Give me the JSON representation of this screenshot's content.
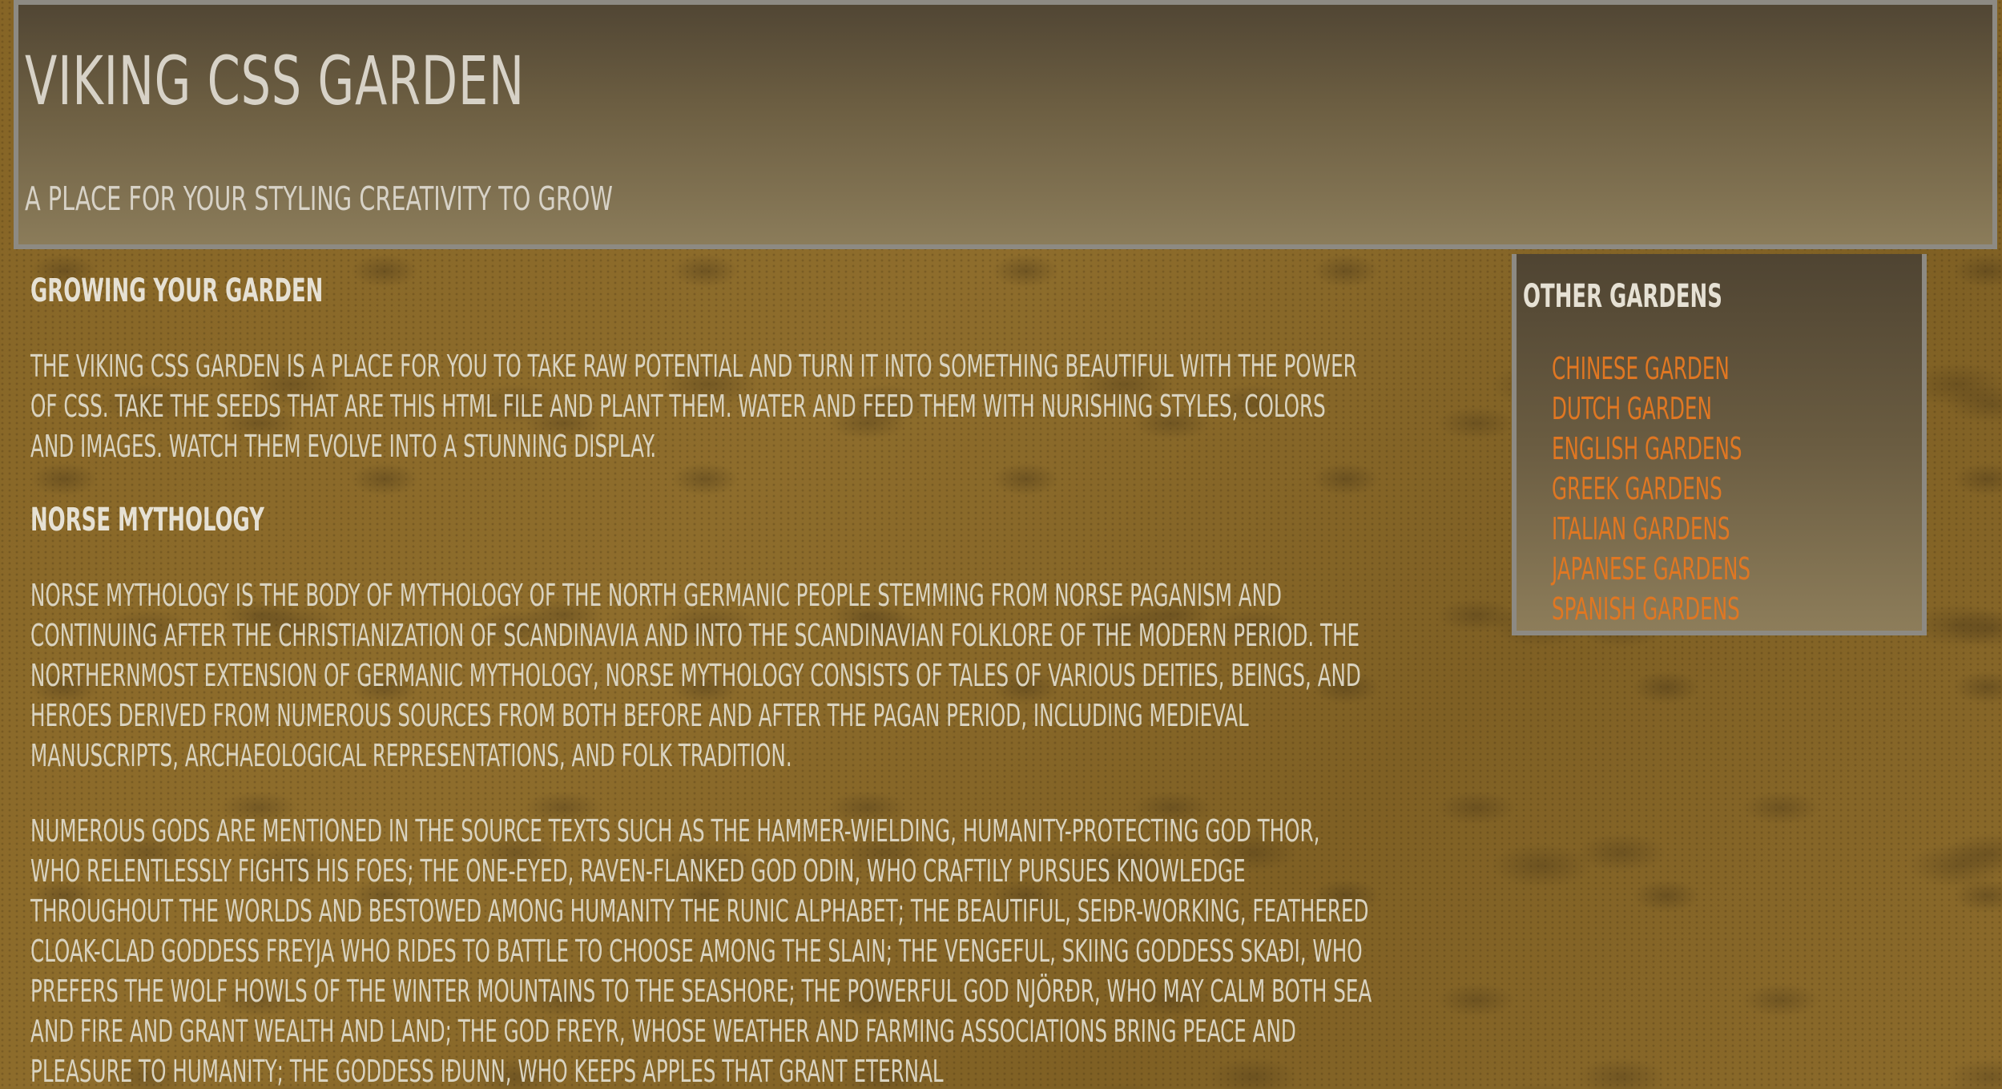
{
  "header": {
    "title": "Viking CSS Garden",
    "tagline": "A place for your styling creativity to grow"
  },
  "main": {
    "section1": {
      "heading": "Growing Your Garden",
      "paragraph": "The Viking CSS Garden is a place for you to take raw potential and turn it into something beautiful with the power of CSS. Take the seeds that are this HTML file and plant them. Water and feed them with nurishing styles, colors and images. Watch them evolve into a stunning display."
    },
    "section2": {
      "heading": "Norse Mythology",
      "paragraph1": "Norse mythology is the body of mythology of the North Germanic people stemming from Norse paganism and continuing after the Christianization of Scandinavia and into the Scandinavian folklore of the modern period. The northernmost extension of Germanic mythology, Norse mythology consists of tales of various deities, beings, and heroes derived from numerous sources from both before and after the pagan period, including medieval manuscripts, archaeological representations, and folk tradition.",
      "paragraph2": "Numerous gods are mentioned in the source texts such as the hammer-wielding, humanity-protecting god Thor, who relentlessly fights his foes; the one-eyed, raven-flanked god Odin, who craftily pursues knowledge throughout the worlds and bestowed among humanity the runic alphabet; the beautiful, seiðr-working, feathered cloak-clad goddess Freyja who rides to battle to choose among the slain; the vengeful, skiing goddess Skaði, who prefers the wolf howls of the winter mountains to the seashore; the powerful god Njörðr, who may calm both sea and fire and grant wealth and land; the god Freyr, whose weather and farming associations bring peace and pleasure to humanity; the goddess Iðunn, who keeps apples that grant eternal"
    }
  },
  "sidebar": {
    "heading": "Other Gardens",
    "links": [
      "Chinese Garden",
      "Dutch Garden",
      "English Gardens",
      "Greek Gardens",
      "Italian Gardens",
      "Japanese Gardens",
      "Spanish Gardens"
    ]
  },
  "colors": {
    "link": "#e07722",
    "text": "#d9d3c0",
    "border": "#8d8a83",
    "background": "#8a6a2a"
  }
}
